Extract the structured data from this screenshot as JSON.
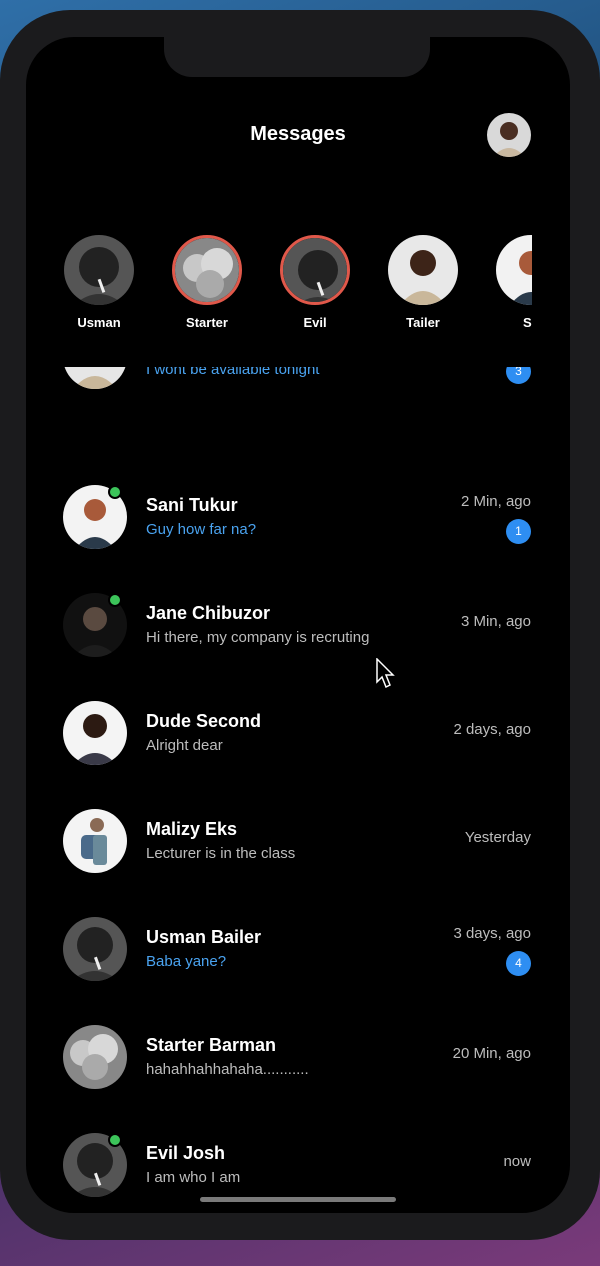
{
  "header": {
    "title": "Messages",
    "theme_toggle_icon": "moon-icon",
    "profile_avatar": "user-avatar"
  },
  "stories": [
    {
      "label": "Usman",
      "active": false,
      "avatar": "elder-man"
    },
    {
      "label": "Starter",
      "active": true,
      "avatar": "clouds"
    },
    {
      "label": "Evil",
      "active": true,
      "avatar": "elder-man"
    },
    {
      "label": "Tailer",
      "active": false,
      "avatar": "young-man"
    },
    {
      "label": "Sa",
      "active": false,
      "avatar": "woman"
    }
  ],
  "conversations": [
    {
      "name": "",
      "message": "I wont be available tonight",
      "time": "",
      "badge": "3",
      "unread": true,
      "online": false,
      "avatar": "young-man"
    },
    {
      "name": "Sani Tukur",
      "message": "Guy how far na?",
      "time": "2 Min, ago",
      "badge": "1",
      "unread": true,
      "online": true,
      "avatar": "woman"
    },
    {
      "name": "Jane Chibuzor",
      "message": "Hi there, my company is recruting",
      "time": "3 Min, ago",
      "badge": "",
      "unread": false,
      "online": true,
      "avatar": "dark-person"
    },
    {
      "name": "Dude Second",
      "message": "Alright dear",
      "time": "2 days, ago",
      "badge": "",
      "unread": false,
      "online": false,
      "avatar": "woman-dark"
    },
    {
      "name": "Malizy Eks",
      "message": "Lecturer is in the class",
      "time": "Yesterday",
      "badge": "",
      "unread": false,
      "online": false,
      "avatar": "traveler"
    },
    {
      "name": "Usman Bailer",
      "message": "Baba yane?",
      "time": "3 days, ago",
      "badge": "4",
      "unread": true,
      "online": false,
      "avatar": "elder-man"
    },
    {
      "name": "Starter Barman",
      "message": "hahahhahhahaha...........",
      "time": "20 Min, ago",
      "badge": "",
      "unread": false,
      "online": false,
      "avatar": "clouds"
    },
    {
      "name": "Evil Josh",
      "message": "I am who I am",
      "time": "now",
      "badge": "",
      "unread": false,
      "online": true,
      "avatar": "elder-man"
    }
  ],
  "colors": {
    "unread_text": "#4aa3f0",
    "badge": "#2e8ef2",
    "story_ring": "#e0584a",
    "online": "#3cc45a"
  }
}
